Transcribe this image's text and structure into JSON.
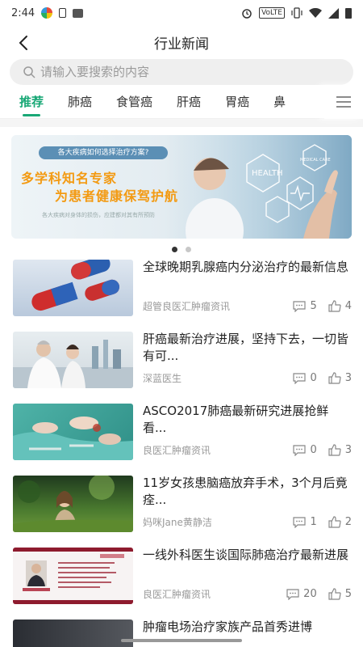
{
  "status_bar": {
    "time": "2:44",
    "network": "VoLTE"
  },
  "header": {
    "title": "行业新闻"
  },
  "search": {
    "placeholder": "请输入要搜索的内容"
  },
  "tabs": [
    {
      "label": "推荐",
      "active": true
    },
    {
      "label": "肺癌",
      "active": false
    },
    {
      "label": "食管癌",
      "active": false
    },
    {
      "label": "肝癌",
      "active": false
    },
    {
      "label": "胃癌",
      "active": false
    },
    {
      "label": "鼻",
      "active": false
    }
  ],
  "banner": {
    "pill": "各大疾病如何选择治疗方案?",
    "line1": "多学科知名专家",
    "line2": "为患者健康保驾护航",
    "small": "各大疾病对身体的损伤，应建都对其有所预防",
    "health_label": "HEALTH",
    "medical_label": "MEDICAL CARE"
  },
  "carousel": {
    "count": 2,
    "active": 0
  },
  "news": [
    {
      "title": "全球晚期乳腺癌内分泌治疗的最新信息",
      "source": "超管良医汇肿瘤资讯",
      "comments": "5",
      "likes": "4"
    },
    {
      "title": "肝癌最新治疗进展，坚持下去，一切皆有可...",
      "source": "深蓝医生",
      "comments": "0",
      "likes": "3"
    },
    {
      "title": "ASCO2017肺癌最新研究进展抢鲜看...",
      "source": "良医汇肿瘤资讯",
      "comments": "0",
      "likes": "3"
    },
    {
      "title": "11岁女孩患脑癌放弃手术，3个月后竟痊...",
      "source": "妈咪Jane黄静洁",
      "comments": "1",
      "likes": "2"
    },
    {
      "title": "一线外科医生谈国际肺癌治疗最新进展",
      "source": "良医汇肿瘤资讯",
      "comments": "20",
      "likes": "5"
    },
    {
      "title": "肿瘤电场治疗家族产品首秀进博",
      "source": "",
      "comments": "",
      "likes": ""
    }
  ],
  "colors": {
    "accent": "#19a876",
    "banner_text": "#f39a12"
  }
}
